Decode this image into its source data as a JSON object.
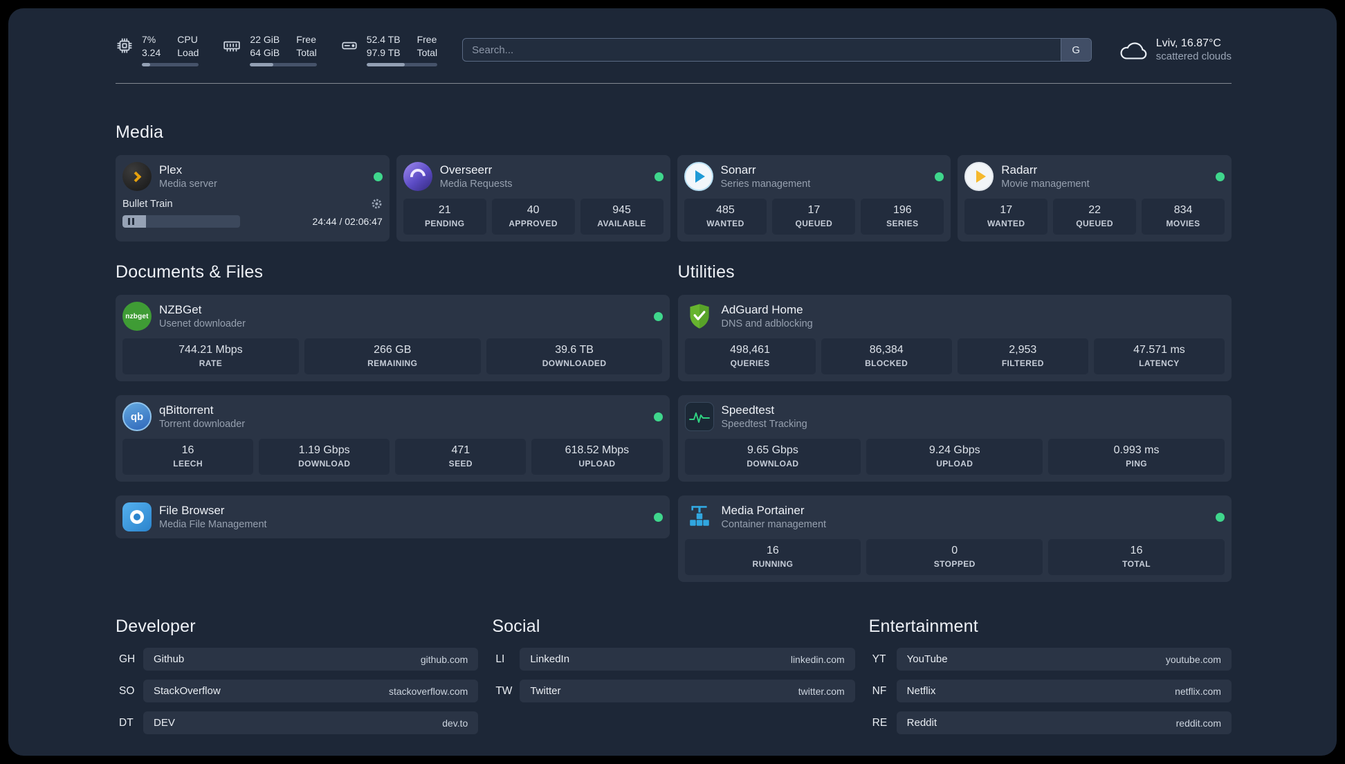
{
  "colors": {
    "status_online": "#3fd68c",
    "page_bg": "#1d2737",
    "card_bg": "#2a3445"
  },
  "topbar": {
    "cpu": {
      "value1": "7%",
      "value2": "3.24",
      "label1": "CPU",
      "label2": "Load",
      "bar_percent": 15
    },
    "memory": {
      "value1": "22 GiB",
      "value2": "64 GiB",
      "label1": "Free",
      "label2": "Total",
      "bar_percent": 35
    },
    "disk": {
      "value1": "52.4 TB",
      "value2": "97.9 TB",
      "label1": "Free",
      "label2": "Total",
      "bar_percent": 54
    },
    "search": {
      "placeholder": "Search...",
      "provider": "G"
    },
    "weather": {
      "location": "Lviv, 16.87°C",
      "condition": "scattered clouds"
    }
  },
  "icons": {
    "nzbget_label": "nzbget",
    "qbittorrent_label": "qb"
  },
  "media": {
    "title": "Media",
    "cards": [
      {
        "name": "Plex",
        "desc": "Media server",
        "player": {
          "track": "Bullet Train",
          "time": "24:44 / 02:06:47",
          "progress_percent": 20
        }
      },
      {
        "name": "Overseerr",
        "desc": "Media Requests",
        "stats": [
          {
            "value": "21",
            "label": "PENDING"
          },
          {
            "value": "40",
            "label": "APPROVED"
          },
          {
            "value": "945",
            "label": "AVAILABLE"
          }
        ]
      },
      {
        "name": "Sonarr",
        "desc": "Series management",
        "stats": [
          {
            "value": "485",
            "label": "WANTED"
          },
          {
            "value": "17",
            "label": "QUEUED"
          },
          {
            "value": "196",
            "label": "SERIES"
          }
        ]
      },
      {
        "name": "Radarr",
        "desc": "Movie management",
        "stats": [
          {
            "value": "17",
            "label": "WANTED"
          },
          {
            "value": "22",
            "label": "QUEUED"
          },
          {
            "value": "834",
            "label": "MOVIES"
          }
        ]
      }
    ]
  },
  "documents": {
    "title": "Documents & Files",
    "cards": [
      {
        "name": "NZBGet",
        "desc": "Usenet downloader",
        "stats": [
          {
            "value": "744.21 Mbps",
            "label": "RATE"
          },
          {
            "value": "266 GB",
            "label": "REMAINING"
          },
          {
            "value": "39.6 TB",
            "label": "DOWNLOADED"
          }
        ]
      },
      {
        "name": "qBittorrent",
        "desc": "Torrent downloader",
        "stats": [
          {
            "value": "16",
            "label": "LEECH"
          },
          {
            "value": "1.19 Gbps",
            "label": "DOWNLOAD"
          },
          {
            "value": "471",
            "label": "SEED"
          },
          {
            "value": "618.52 Mbps",
            "label": "UPLOAD"
          }
        ]
      },
      {
        "name": "File Browser",
        "desc": "Media File Management"
      }
    ]
  },
  "utilities": {
    "title": "Utilities",
    "cards": [
      {
        "name": "AdGuard Home",
        "desc": "DNS and adblocking",
        "stats": [
          {
            "value": "498,461",
            "label": "QUERIES"
          },
          {
            "value": "86,384",
            "label": "BLOCKED"
          },
          {
            "value": "2,953",
            "label": "FILTERED"
          },
          {
            "value": "47.571 ms",
            "label": "LATENCY"
          }
        ]
      },
      {
        "name": "Speedtest",
        "desc": "Speedtest Tracking",
        "stats": [
          {
            "value": "9.65 Gbps",
            "label": "DOWNLOAD"
          },
          {
            "value": "9.24 Gbps",
            "label": "UPLOAD"
          },
          {
            "value": "0.993 ms",
            "label": "PING"
          }
        ]
      },
      {
        "name": "Media Portainer",
        "desc": "Container management",
        "stats": [
          {
            "value": "16",
            "label": "RUNNING"
          },
          {
            "value": "0",
            "label": "STOPPED"
          },
          {
            "value": "16",
            "label": "TOTAL"
          }
        ]
      }
    ]
  },
  "bookmarks": {
    "groups": [
      {
        "title": "Developer",
        "items": [
          {
            "abbr": "GH",
            "name": "Github",
            "url": "github.com"
          },
          {
            "abbr": "SO",
            "name": "StackOverflow",
            "url": "stackoverflow.com"
          },
          {
            "abbr": "DT",
            "name": "DEV",
            "url": "dev.to"
          }
        ]
      },
      {
        "title": "Social",
        "items": [
          {
            "abbr": "LI",
            "name": "LinkedIn",
            "url": "linkedin.com"
          },
          {
            "abbr": "TW",
            "name": "Twitter",
            "url": "twitter.com"
          }
        ]
      },
      {
        "title": "Entertainment",
        "items": [
          {
            "abbr": "YT",
            "name": "YouTube",
            "url": "youtube.com"
          },
          {
            "abbr": "NF",
            "name": "Netflix",
            "url": "netflix.com"
          },
          {
            "abbr": "RE",
            "name": "Reddit",
            "url": "reddit.com"
          }
        ]
      }
    ]
  }
}
